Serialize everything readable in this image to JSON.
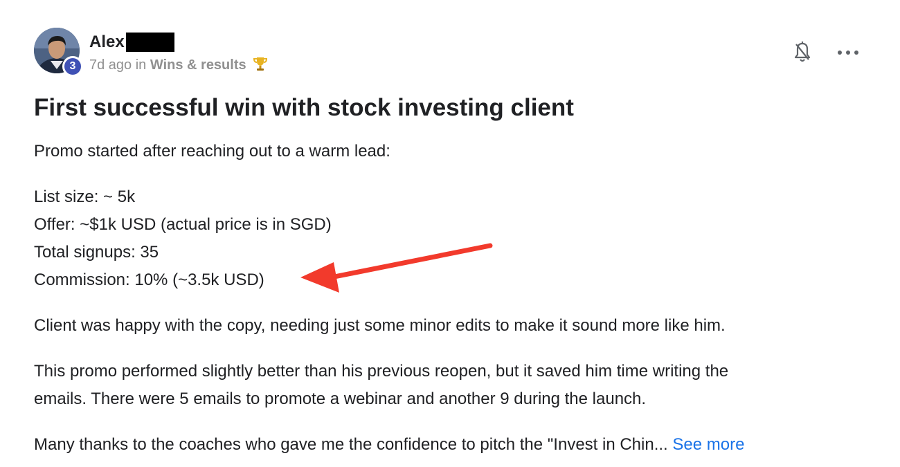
{
  "post": {
    "author": {
      "name": "Alex",
      "level": "3"
    },
    "meta": {
      "time": "7d ago",
      "in_text": "in",
      "category": "Wins & results"
    },
    "title": "First successful win with stock investing client",
    "body": {
      "intro": "Promo started after reaching out to a warm lead:",
      "details": [
        "List size: ~ 5k",
        "Offer: ~$1k USD (actual price is in SGD)",
        "Total signups: 35",
        "Commission: 10% (~3.5k USD)"
      ],
      "paragraph1": "Client was happy with the copy, needing just some minor edits to make it sound more like him.",
      "paragraph2_line1": "This promo performed slightly better than his previous reopen, but it saved him time writing the",
      "paragraph2_line2": "emails. There were 5 emails to promote a webinar and another 9 during the launch.",
      "paragraph3": "Many thanks to the coaches who gave me the confidence to pitch the \"Invest in Chin...",
      "see_more": "See more"
    },
    "icons": {
      "trophy": "trophy-icon",
      "bell": "bell-off-icon",
      "more": "more-horizontal-icon"
    },
    "colors": {
      "badge": "#3f51b5",
      "link": "#1a73e8",
      "arrow": "#f23a2c",
      "muted": "#909090"
    }
  }
}
